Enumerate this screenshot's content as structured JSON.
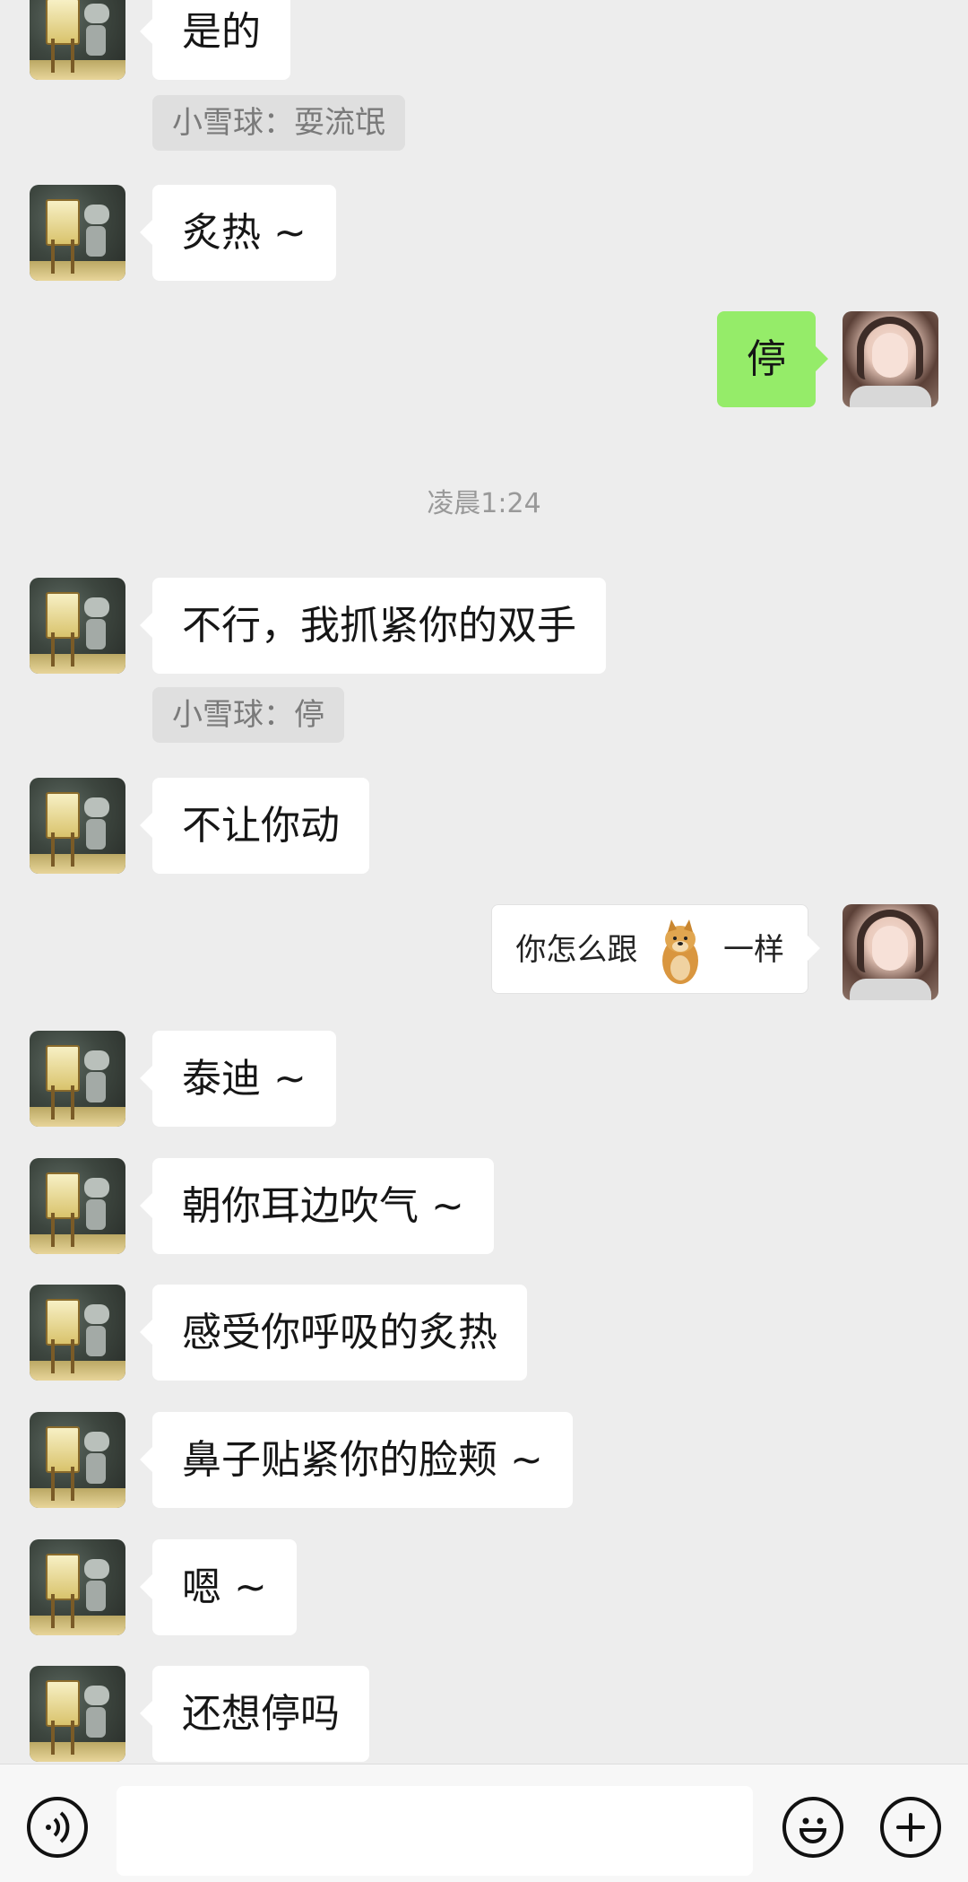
{
  "colors": {
    "background": "#ededed",
    "incoming_bubble": "#ffffff",
    "outgoing_bubble": "#95ec69",
    "quote_background": "#dfdfdf",
    "footer_background": "#f7f7f7"
  },
  "messages": {
    "m1": {
      "sender": "other",
      "text": "是的"
    },
    "q1": {
      "text": "小雪球：耍流氓"
    },
    "m2": {
      "sender": "other",
      "text": "炙热 ~"
    },
    "m3": {
      "sender": "me",
      "text": "停"
    },
    "time1": {
      "text": "凌晨1:24"
    },
    "m4": {
      "sender": "other",
      "text": "不行，我抓紧你的双手"
    },
    "q2": {
      "text": "小雪球：停"
    },
    "m5": {
      "sender": "other",
      "text": "不让你动"
    },
    "m6": {
      "sender": "me",
      "before": "你怎么跟",
      "sticker": "doge-sticker",
      "after": "一样"
    },
    "m7": {
      "sender": "other",
      "text": "泰迪 ~"
    },
    "m8": {
      "sender": "other",
      "text": "朝你耳边吹气 ~"
    },
    "m9": {
      "sender": "other",
      "text": "感受你呼吸的炙热"
    },
    "m10": {
      "sender": "other",
      "text": "鼻子贴紧你的脸颊 ~"
    },
    "m11": {
      "sender": "other",
      "text": "嗯 ~"
    },
    "m12": {
      "sender": "other",
      "text": "还想停吗"
    }
  },
  "footer": {
    "voice_icon": "voice-icon",
    "emoji_icon": "smiley-icon",
    "plus_icon": "plus-icon",
    "input_value": ""
  }
}
